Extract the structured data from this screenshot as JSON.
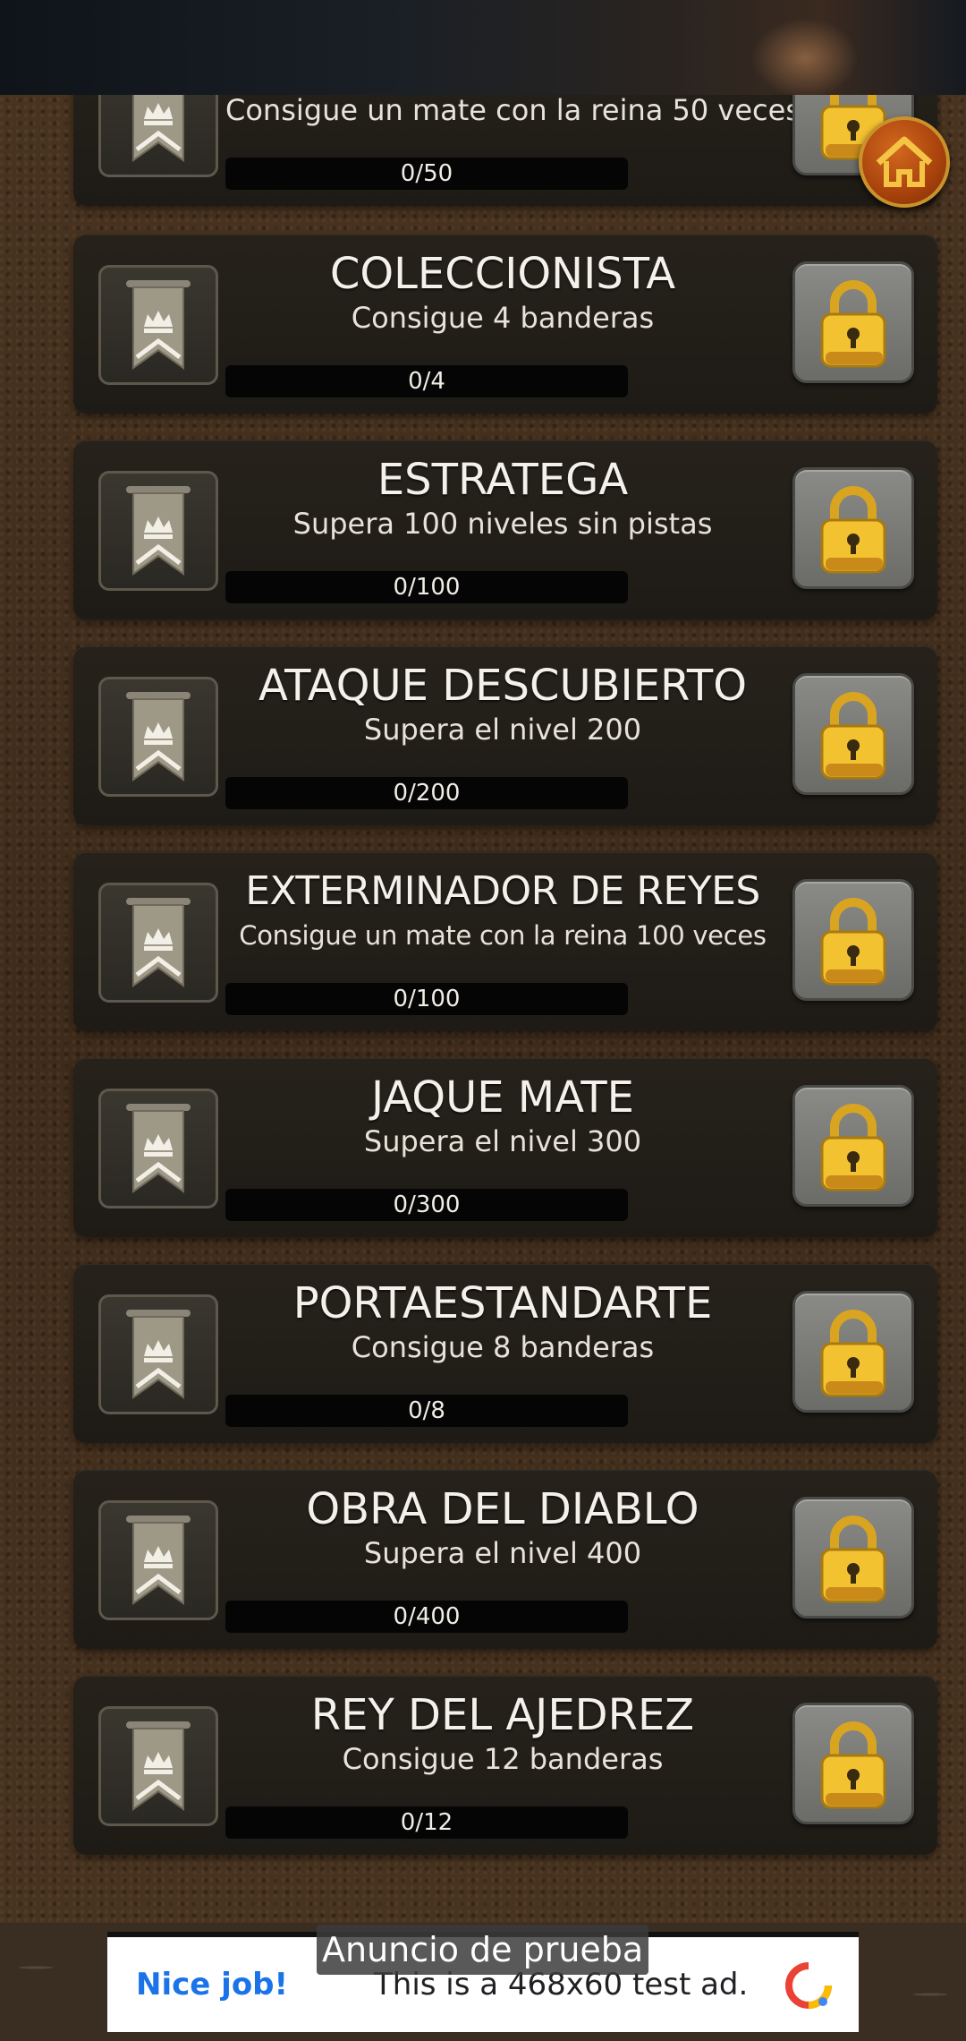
{
  "achievements": [
    {
      "title": "",
      "description": "Consigue un mate con la reina 50 veces",
      "progress_text": "0/50",
      "progress": 0,
      "locked": true
    },
    {
      "title": "COLECCIONISTA",
      "description": "Consigue 4 banderas",
      "progress_text": "0/4",
      "progress": 0,
      "locked": true
    },
    {
      "title": "ESTRATEGA",
      "description": "Supera 100 niveles sin pistas",
      "progress_text": "0/100",
      "progress": 0,
      "locked": true
    },
    {
      "title": "ATAQUE DESCUBIERTO",
      "description": "Supera el nivel 200",
      "progress_text": "0/200",
      "progress": 0,
      "locked": true
    },
    {
      "title": "EXTERMINADOR DE REYES",
      "description": "Consigue un mate con la reina 100 veces",
      "progress_text": "0/100",
      "progress": 0,
      "locked": true
    },
    {
      "title": "JAQUE MATE",
      "description": "Supera el nivel 300",
      "progress_text": "0/300",
      "progress": 0,
      "locked": true
    },
    {
      "title": "PORTAESTANDARTE",
      "description": "Consigue 8 banderas",
      "progress_text": "0/8",
      "progress": 0,
      "locked": true
    },
    {
      "title": "OBRA DEL DIABLO",
      "description": "Supera el nivel 400",
      "progress_text": "0/400",
      "progress": 0,
      "locked": true
    },
    {
      "title": "REY DEL AJEDREZ",
      "description": "Consigue 12 banderas",
      "progress_text": "0/12",
      "progress": 0,
      "locked": true
    }
  ],
  "icons": {
    "banner": "crown-banner-icon",
    "lock": "padlock-icon",
    "home": "home-icon"
  },
  "ad": {
    "label": "Anuncio de prueba",
    "headline": "Nice job!",
    "text": "This is a 468x60 test ad."
  },
  "colors": {
    "accent_gold": "#f2c230",
    "home_orange": "#b8500f",
    "ad_blue": "#1a73e8"
  }
}
